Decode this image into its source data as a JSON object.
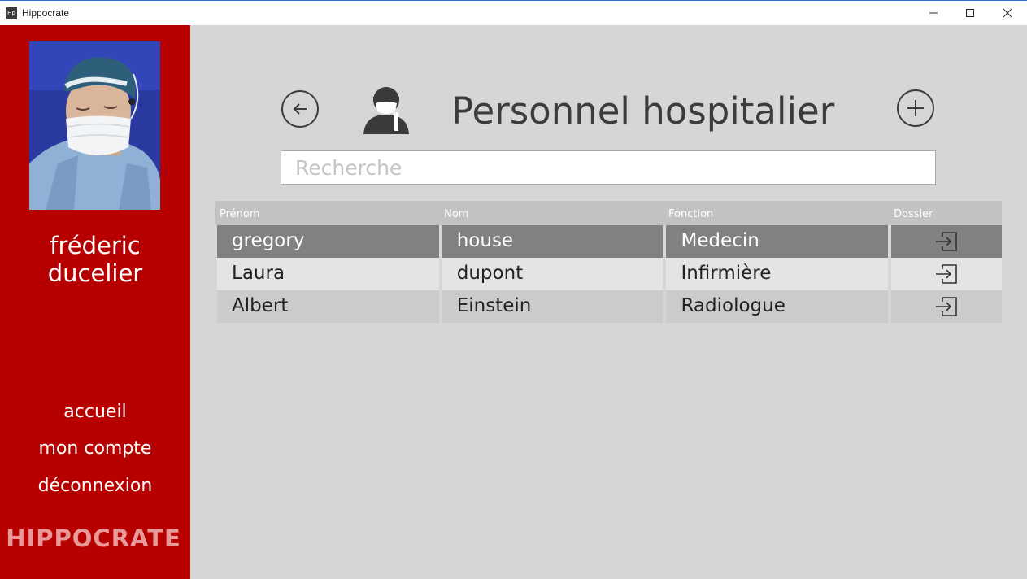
{
  "window": {
    "app_icon_text": "Hp",
    "title": "Hippocrate",
    "controls": [
      "minimize",
      "maximize",
      "close"
    ]
  },
  "sidebar": {
    "username": "fréderic ducelier",
    "nav": [
      {
        "label": "accueil"
      },
      {
        "label": "mon compte"
      },
      {
        "label": "déconnexion"
      }
    ],
    "brand": "HIPPOCRATE"
  },
  "main": {
    "title": "Personnel hospitalier",
    "search_placeholder": "Recherche",
    "search_value": "",
    "table": {
      "headers": [
        "Prénom",
        "Nom",
        "Fonction",
        "Dossier"
      ],
      "rows": [
        {
          "prenom": "gregory",
          "nom": "house",
          "fonction": "Medecin"
        },
        {
          "prenom": "Laura",
          "nom": "dupont",
          "fonction": "Infirmière"
        },
        {
          "prenom": "Albert",
          "nom": "Einstein",
          "fonction": "Radiologue"
        }
      ]
    }
  },
  "colors": {
    "sidebar_bg": "#b70000",
    "main_bg": "#d6d6d6",
    "selected_row": "#818181"
  }
}
